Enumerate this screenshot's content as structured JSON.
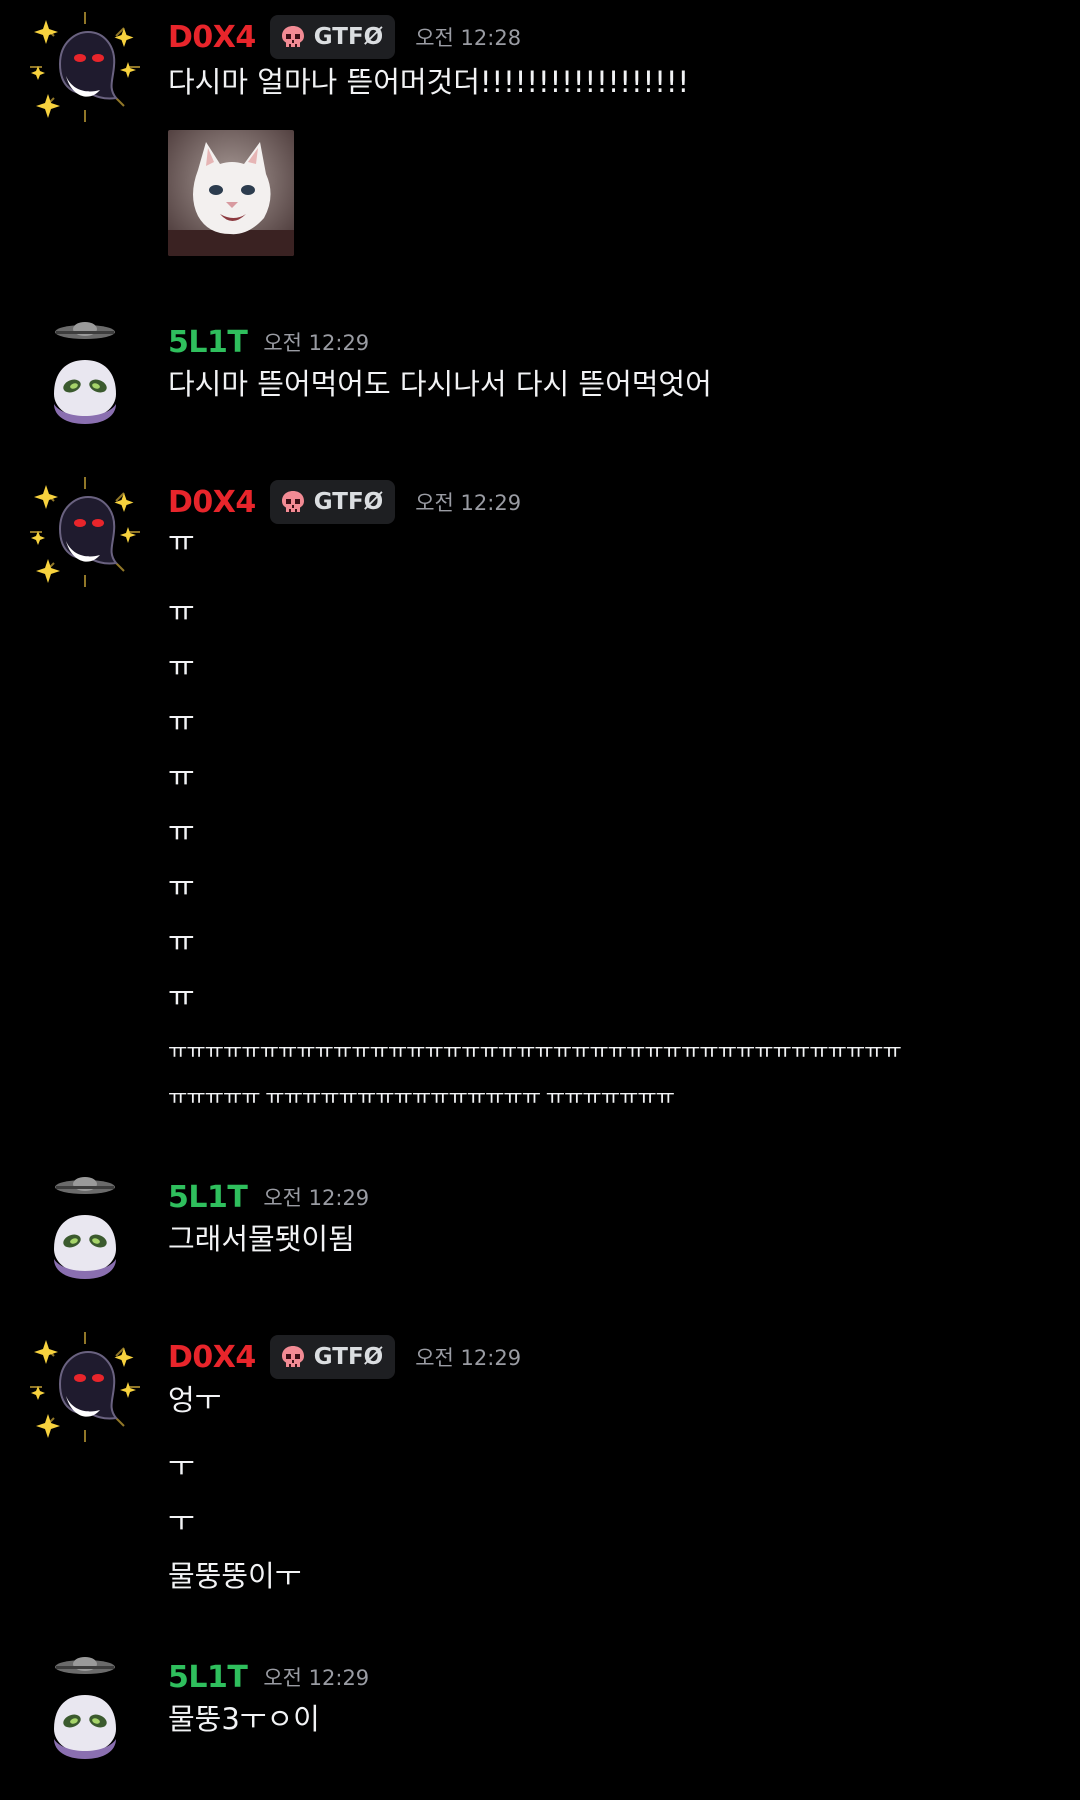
{
  "colors": {
    "background": "#000000",
    "user_red": "#e8252b",
    "user_green": "#2fbf5d",
    "tag_bg": "#1e1f22",
    "timestamp": "#9a9ca3",
    "text": "#f2f3f5"
  },
  "messages": [
    {
      "username": "D0X4",
      "username_color": "#e8252b",
      "avatar_icon": "ghost-sparkle-avatar-icon",
      "tag": {
        "icon": "skull-icon",
        "label": "GTFØ"
      },
      "time": "오전 12:28",
      "lines": [
        "다시마 얼마나 뜯어머것더!!!!!!!!!!!!!!!!!!"
      ],
      "sticker": "crying-white-kitten-sticker"
    },
    {
      "username": "5L1T",
      "username_color": "#2fbf5d",
      "avatar_icon": "alien-ufo-avatar-icon",
      "time": "오전 12:29",
      "lines": [
        "다시마 뜯어먹어도 다시나서 다시 뜯어먹엇어"
      ]
    },
    {
      "username": "D0X4",
      "username_color": "#e8252b",
      "avatar_icon": "ghost-sparkle-avatar-icon",
      "tag": {
        "icon": "skull-icon",
        "label": "GTFØ"
      },
      "time": "오전 12:29",
      "lines": [
        "ㅠ",
        "ㅠ",
        "ㅠ",
        "ㅠ",
        "ㅠ",
        "ㅠ",
        "ㅠ",
        "ㅠ",
        "ㅠ",
        "ㅠㅠㅠㅠㅠㅠㅠㅠㅠㅠㅠㅠㅠㅠㅠㅠㅠㅠㅠㅠㅠㅠㅠㅠㅠㅠㅠㅠㅠㅠㅠㅠㅠㅠㅠㅠㅠㅠㅠㅠ",
        "ㅠㅠㅠㅠㅠ  ㅠㅠㅠㅠㅠㅠㅠㅠㅠㅠㅠㅠㅠㅠㅠ ㅠㅠㅠㅠㅠㅠㅠ"
      ]
    },
    {
      "username": "5L1T",
      "username_color": "#2fbf5d",
      "avatar_icon": "alien-ufo-avatar-icon",
      "time": "오전 12:29",
      "lines": [
        "그래서물됏이됨"
      ]
    },
    {
      "username": "D0X4",
      "username_color": "#e8252b",
      "avatar_icon": "ghost-sparkle-avatar-icon",
      "tag": {
        "icon": "skull-icon",
        "label": "GTFØ"
      },
      "time": "오전 12:29",
      "lines": [
        "엉ㅜ",
        "ㅜ",
        "ㅜ",
        "물뚱뚱이ㅜ"
      ]
    },
    {
      "username": "5L1T",
      "username_color": "#2fbf5d",
      "avatar_icon": "alien-ufo-avatar-icon",
      "time": "오전 12:29",
      "lines": [
        "물뚱3ㅜㅇ이"
      ]
    }
  ]
}
